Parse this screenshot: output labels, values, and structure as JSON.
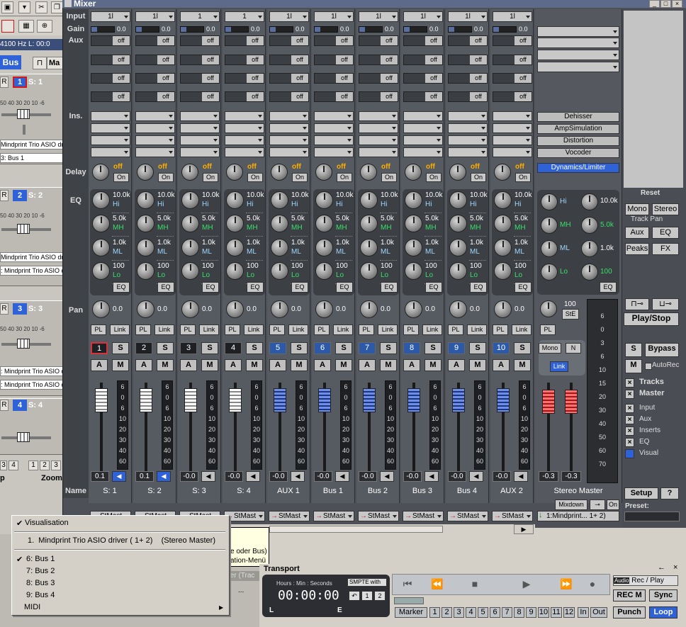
{
  "editor": {
    "freq_display": "4100 Hz L: 00:0",
    "bus_button": "Bus",
    "ruler_labels": "50 40 30 20 10 -6",
    "tracks": [
      {
        "rec": "R",
        "num": "1",
        "name": "S: 1",
        "driver": "Mindprint Trio ASIO dr",
        "driver2": "3: Bus 1"
      },
      {
        "rec": "R",
        "num": "2",
        "name": "S: 2",
        "driver": "Mindprint Trio ASIO dr",
        "driver2": ": Mindprint Trio ASIO d"
      },
      {
        "rec": "R",
        "num": "3",
        "name": "S: 3",
        "driver": ": Mindprint Trio ASIO dr",
        "driver2": ": Mindprint Trio ASIO d"
      },
      {
        "rec": "R",
        "num": "4",
        "name": "S: 4",
        "driver": "",
        "driver2": ""
      }
    ],
    "bottom_nums": [
      "3",
      "4",
      "1",
      "2",
      "3"
    ],
    "bottom_labels": {
      "left": "p",
      "right": "Zoom"
    }
  },
  "mixer": {
    "title": "Mixer",
    "row_labels": {
      "input": "Input",
      "gain": "Gain",
      "aux": "Aux",
      "ins": "Ins.",
      "delay": "Delay",
      "eq": "EQ",
      "pan": "Pan",
      "name": "Name"
    },
    "aux_off": "off",
    "delay_off": "off",
    "on_label": "On",
    "eq_button": "EQ",
    "pl_label": "PL",
    "link_label": "Link",
    "solo": "S",
    "arm": "A",
    "mute": "M",
    "eq_values": {
      "hi": "10.0k",
      "mh": "5.0k",
      "ml": "1.0k",
      "lo": "100"
    },
    "eq_labels": {
      "hi": "Hi",
      "mh": "MH",
      "ml": "ML",
      "lo": "Lo"
    },
    "meter_scale": [
      "6",
      "0",
      "6",
      "10",
      "20",
      "30",
      "40",
      "60"
    ],
    "channels": [
      {
        "input": "1l",
        "gain": "0.0",
        "pan": "0.0",
        "number": "1",
        "name": "S: 1",
        "fader": "0.1",
        "output": "StMast",
        "type": "white",
        "selected": true,
        "spk_active": true
      },
      {
        "input": "1l",
        "gain": "0.0",
        "pan": "0.0",
        "number": "2",
        "name": "S: 2",
        "fader": "0.1",
        "output": "StMast",
        "type": "white",
        "selected": false,
        "spk_active": true
      },
      {
        "input": "1",
        "gain": "0.0",
        "pan": "0.0",
        "number": "3",
        "name": "S: 3",
        "fader": "-0.0",
        "output": "StMast",
        "type": "white",
        "selected": false,
        "spk_active": false
      },
      {
        "input": "1",
        "gain": "0.0",
        "pan": "0.0",
        "number": "4",
        "name": "S: 4",
        "fader": "-0.0",
        "output": "StMast",
        "type": "white",
        "selected": false,
        "spk_active": false
      },
      {
        "input": "1l",
        "gain": "0.0",
        "pan": "0.0",
        "number": "5",
        "name": "AUX 1",
        "fader": "-0.0",
        "output": "StMast",
        "type": "blue",
        "selected": false,
        "spk_active": false
      },
      {
        "input": "1l",
        "gain": "0.0",
        "pan": "0.0",
        "number": "6",
        "name": "Bus 1",
        "fader": "-0.0",
        "output": "StMast",
        "type": "blue",
        "selected": false,
        "spk_active": false
      },
      {
        "input": "1l",
        "gain": "0.0",
        "pan": "0.0",
        "number": "7",
        "name": "Bus 2",
        "fader": "-0.0",
        "output": "StMast",
        "type": "blue",
        "selected": false,
        "spk_active": false
      },
      {
        "input": "1l",
        "gain": "0.0",
        "pan": "0.0",
        "number": "8",
        "name": "Bus 3",
        "fader": "-0.0",
        "output": "StMast",
        "type": "blue",
        "selected": false,
        "spk_active": false
      },
      {
        "input": "1l",
        "gain": "0.0",
        "pan": "0.0",
        "number": "9",
        "name": "Bus 4",
        "fader": "-0.0",
        "output": "StMast",
        "type": "blue",
        "selected": false,
        "spk_active": false
      },
      {
        "input": "1l",
        "gain": "0.0",
        "pan": "0.0",
        "number": "10",
        "name": "AUX 2",
        "fader": "-0.0",
        "output": "StMast",
        "type": "blue",
        "selected": false,
        "spk_active": false
      }
    ],
    "master": {
      "fx": [
        "Dehisser",
        "AmpSimulation",
        "Distortion",
        "Vocoder",
        "Dynamics/Limiter"
      ],
      "eq_values": {
        "hi": "10.0k",
        "mh": "5.0k",
        "ml": "1.0k",
        "lo": "100"
      },
      "pan_value": "100",
      "pan_mode": "StE",
      "pl_label": "PL",
      "mono": "Mono",
      "n": "N",
      "link": "Link",
      "fader_left": "-0.3",
      "fader_right": "-0.3",
      "name": "Stereo Master",
      "mixdown": "Mixdown",
      "on": "On",
      "output": "1:Mindprint... 1+ 2)",
      "big_meter_scale": [
        "6",
        "0",
        "3",
        "6",
        "10",
        "15",
        "20",
        "30",
        "40",
        "50",
        "60",
        "70"
      ]
    },
    "side": {
      "reset": "Reset",
      "mono": "Mono",
      "stereo": "Stereo",
      "track_pan": "Track Pan",
      "aux": "Aux",
      "eq": "EQ",
      "peaks": "Peaks",
      "fx": "FX",
      "play_stop": "Play/Stop",
      "s": "S",
      "bypass": "Bypass",
      "m": "M",
      "autorec": "AutoRec",
      "tracks": "Tracks",
      "master": "Master",
      "input": "Input",
      "aux2": "Aux",
      "inserts": "Inserts",
      "eq2": "EQ",
      "visual": "Visual",
      "setup": "Setup",
      "help": "?",
      "preset": "Preset:"
    }
  },
  "context_menu": {
    "items": [
      {
        "label": "Visualisation",
        "checked": true
      },
      {
        "label": "1.  Mindprint Trio ASIO driver ( 1+ 2)    (Stereo Master)",
        "checked": false
      },
      {
        "label": "6: Bus  1",
        "checked": true
      },
      {
        "label": "7: Bus  2",
        "checked": false
      },
      {
        "label": "8: Bus  3",
        "checked": false
      },
      {
        "label": "9: Bus  4",
        "checked": false
      },
      {
        "label": "MIDI",
        "checked": false
      }
    ],
    "submenu_arrow": "▶"
  },
  "tooltip": {
    "line1": "e oder Bus)",
    "line2": "ation-Menü"
  },
  "behind": {
    "text": "ter (Trac",
    "dots": "..."
  },
  "transport": {
    "title": "Transport",
    "time_format": "Hours : Min : Seconds",
    "smpte": "SMPTE with",
    "time": "00:00:00",
    "l_marker": "L",
    "e_marker": "E",
    "loop_nums": [
      "1",
      "2"
    ],
    "audio": "Audio",
    "rec_play": "Rec / Play",
    "rec_m": "REC M",
    "sync": "Sync",
    "marker": "Marker",
    "marker_nums": [
      "1",
      "2",
      "3",
      "4",
      "5",
      "6",
      "7",
      "8",
      "9",
      "10",
      "11",
      "12"
    ],
    "in": "In",
    "out": "Out",
    "punch": "Punch",
    "loop": "Loop"
  }
}
